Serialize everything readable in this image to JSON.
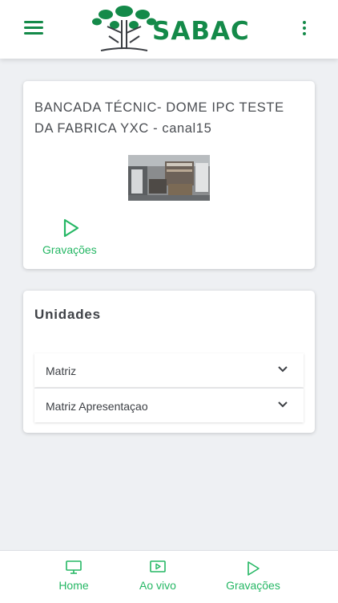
{
  "header": {
    "brand_text": "SABAC",
    "menu_icon": "hamburger-menu-icon",
    "more_icon": "more-vertical-icon",
    "brand_color": "#148a49"
  },
  "camera_card": {
    "title": "BANCADA TÉCNIC- DOME IPC TESTE DA FABRICA YXC - canal15",
    "recordings_label": "Gravações",
    "recordings_icon": "play-outline-icon"
  },
  "units": {
    "title": "Unidades",
    "items": [
      {
        "label": "Matriz",
        "icon": "chevron-down-icon"
      },
      {
        "label": "Matriz Apresentaçao",
        "icon": "chevron-down-icon"
      }
    ]
  },
  "bottom_nav": {
    "items": [
      {
        "label": "Home",
        "icon": "monitor-icon"
      },
      {
        "label": "Ao vivo",
        "icon": "live-video-icon"
      },
      {
        "label": "Gravações",
        "icon": "play-outline-icon"
      }
    ],
    "accent_color": "#25b764"
  }
}
